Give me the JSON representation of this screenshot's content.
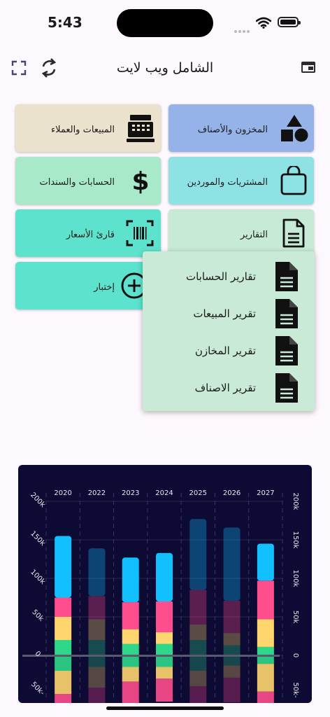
{
  "status": {
    "time": "5:43"
  },
  "header": {
    "title": "الشامل ويب لايت"
  },
  "menu": [
    {
      "label": "المخزون والأصناف",
      "icon": "shapes-icon",
      "color": "#95b3e8"
    },
    {
      "label": "المبيعات والعملاء",
      "icon": "cash-register-icon",
      "color": "#ebe2cd"
    },
    {
      "label": "المشتريات والموردين",
      "icon": "shopping-bag-icon",
      "color": "#8fe2e4"
    },
    {
      "label": "الحسابات والسندات",
      "icon": "dollar-icon",
      "color": "#a8e9c9"
    },
    {
      "label": "التقارير",
      "icon": "document-icon",
      "color": "#c6ead6"
    },
    {
      "label": "قارئ الأسعار",
      "icon": "barcode-scan-icon",
      "color": "#5de2ce"
    },
    {
      "label": "إختبار",
      "icon": "plus-circle-icon",
      "color": "#5de2ce"
    }
  ],
  "reports_menu": [
    {
      "label": "تقارير الحسابات"
    },
    {
      "label": "تقرير المبيعات"
    },
    {
      "label": "تقرير المخازن"
    },
    {
      "label": "تقرير الاصناف"
    }
  ],
  "chart_data": {
    "type": "bar",
    "stacked": true,
    "categories": [
      "2020",
      "2022",
      "2023",
      "2024",
      "2025",
      "2026",
      "2027"
    ],
    "y_ticks_left": [
      "200k",
      "150k",
      "100k",
      "50k",
      "0",
      "50k-"
    ],
    "y_ticks_right": [
      "200k",
      "150k",
      "100k",
      "50k",
      "0",
      "50k-"
    ],
    "ylim": [
      -50000,
      200000
    ],
    "highlighted": [
      true,
      false,
      true,
      true,
      false,
      false,
      true
    ],
    "colors": {
      "background": "#0d0a33",
      "segments": [
        "#2fd889",
        "#ffd66e",
        "#ff4d8d",
        "#13c0ff"
      ],
      "negative": [
        "#2fd889",
        "#ffd66e",
        "#ff4d8d",
        "#8a2a6a"
      ]
    },
    "positive_segments": [
      [
        20000,
        30000,
        25000,
        80000
      ],
      [
        20000,
        27000,
        30000,
        62000
      ],
      [
        15000,
        19000,
        35000,
        58000
      ],
      [
        15000,
        15000,
        40000,
        63000
      ],
      [
        20000,
        20000,
        45000,
        92000
      ],
      [
        13000,
        16000,
        42000,
        95000
      ],
      [
        11000,
        36000,
        50000,
        48000
      ]
    ],
    "negative_segments": [
      [
        20000,
        30000,
        25000,
        0
      ],
      [
        15000,
        27000,
        20000,
        0
      ],
      [
        15000,
        19000,
        30000,
        0
      ],
      [
        15000,
        15000,
        30000,
        0
      ],
      [
        20000,
        20000,
        35000,
        0
      ],
      [
        13000,
        16000,
        32000,
        0
      ],
      [
        11000,
        36000,
        40000,
        0
      ]
    ]
  }
}
